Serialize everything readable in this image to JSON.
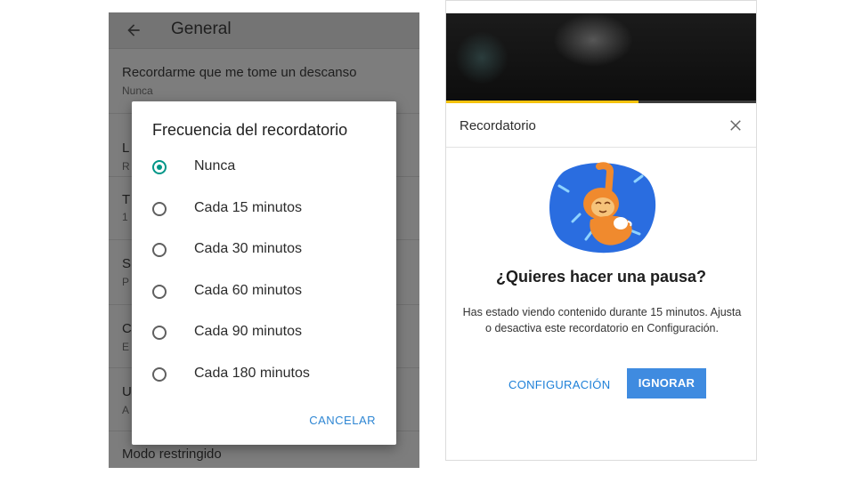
{
  "settings": {
    "title": "General",
    "rows": [
      {
        "title": "Recordarme que me tome un descanso",
        "subtitle": "Nunca"
      },
      {
        "title": "L",
        "subtitle": "R"
      },
      {
        "title": "T",
        "subtitle": "1"
      },
      {
        "title": "S",
        "subtitle": "P"
      },
      {
        "title": "C",
        "subtitle": "E"
      },
      {
        "title": "U",
        "subtitle": "A"
      },
      {
        "title": "Modo restringido",
        "subtitle": ""
      }
    ]
  },
  "dialog": {
    "title": "Frecuencia del recordatorio",
    "options": [
      {
        "label": "Nunca",
        "selected": true
      },
      {
        "label": "Cada 15 minutos",
        "selected": false
      },
      {
        "label": "Cada 30 minutos",
        "selected": false
      },
      {
        "label": "Cada 60 minutos",
        "selected": false
      },
      {
        "label": "Cada 90 minutos",
        "selected": false
      },
      {
        "label": "Cada 180 minutos",
        "selected": false
      }
    ],
    "cancel_label": "CANCELAR"
  },
  "reminder": {
    "title": "Recordatorio",
    "question": "¿Quieres hacer una pausa?",
    "body": "Has estado viendo contenido durante 15 minutos. Ajusta o desactiva este recordatorio en Configuración.",
    "config_label": "CONFIGURACIÓN",
    "ignore_label": "IGNORAR",
    "video_progress": 0.62
  },
  "colors": {
    "accent_teal": "#009688",
    "link_blue": "#1e80d8",
    "button_blue": "#3f8be0",
    "progress_yellow": "#f4c20d"
  },
  "icons": {
    "back": "arrow-left-icon",
    "close": "close-icon",
    "illustration": "relaxed-monkey-illustration"
  }
}
